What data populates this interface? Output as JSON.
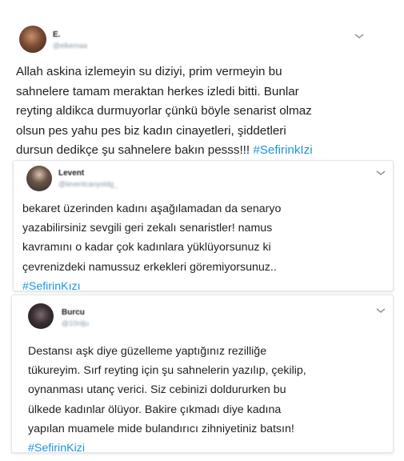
{
  "tweets": [
    {
      "name": "E.",
      "handle": "@elkemaa",
      "lines": [
        "Allah askina izlemeyin su diziyi, prim vermeyin bu",
        "sahnelere tamam meraktan herkes izledi bitti. Bunlar",
        "reyting aldikca durmuyorlar çünkü böyle senarist olmaz",
        "olsun pes yahu pes biz kadın cinayetleri, şiddetleri",
        "dursun dedikçe şu sahnelere bakın pesss!!! "
      ],
      "hashtag": "#SefirinkIzi",
      "avatar_color": "#6b4a3a"
    },
    {
      "name": "Levent",
      "handle": "@leventcanyoldg_",
      "lines": [
        "bekaret üzerinden kadını aşağılamadan da senaryo",
        "yazabilirsiniz sevgili geri zekalı senaristler! namus",
        "kavramını o kadar çok kadınlara yüklüyorsunuz ki",
        "çevrenizdeki namussuz erkekleri göremiyorsunuz.."
      ],
      "hashtag": "#SefirinKızı",
      "avatar_color": "#3a3a3a"
    },
    {
      "name": "Burcu",
      "handle": "@10rdju",
      "lines": [
        "Destansı aşk diye güzelleme yaptığınız rezilliğe",
        "tükureyim. Sırf reyting için şu sahnelerin yazılıp, çekilip,",
        "oynanması utanç verici. Siz cebinizi doldururken bu",
        "ülkede kadınlar ölüyor. Bakire çıkmadı diye kadına",
        "yapılan muamele mide bulandırıcı zihniyetiniz batsın!"
      ],
      "hashtag": "#SefirinKizi",
      "avatar_color": "#2a2628"
    }
  ],
  "icons": {
    "menu": "chevron-down-icon"
  },
  "colors": {
    "hashtag": "#1b95e0",
    "text": "#1c2022",
    "handle": "#8899a6"
  }
}
